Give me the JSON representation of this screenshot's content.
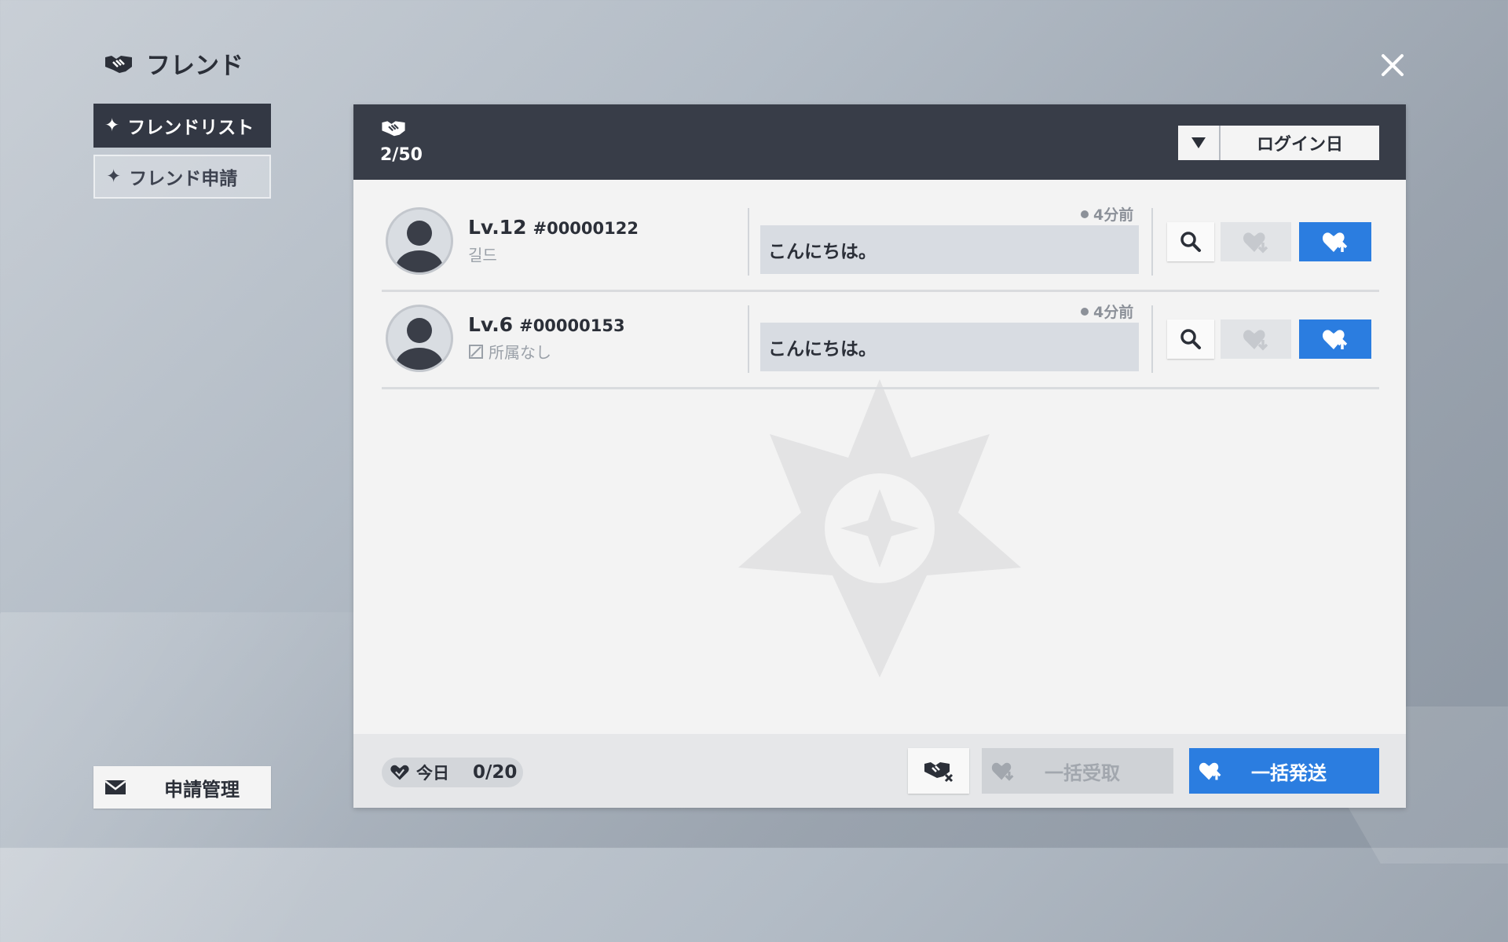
{
  "header": {
    "title": "フレンド",
    "icon": "handshake-icon"
  },
  "tabs": [
    {
      "label": "フレンドリスト",
      "active": true
    },
    {
      "label": "フレンド申請",
      "active": false
    }
  ],
  "manage_button": {
    "label": "申請管理",
    "icon": "mail-icon"
  },
  "panel": {
    "friend_count": "2/50",
    "sort": {
      "selected": "ログイン日"
    }
  },
  "friends": [
    {
      "level": "Lv.12",
      "id": "#00000122",
      "guild": "길드",
      "last_login": "4分前",
      "message": "こんにちは。"
    },
    {
      "level": "Lv.6",
      "id": "#00000153",
      "guild": "所属なし",
      "last_login": "4分前",
      "message": "こんにちは。"
    }
  ],
  "footer": {
    "today_label": "今日",
    "today_value": "0/20",
    "receive_all": "一括受取",
    "send_all": "一括発送"
  },
  "colors": {
    "accent": "#2b7de0",
    "header_dark": "#383d48",
    "disabled": "#cfd2d6"
  }
}
